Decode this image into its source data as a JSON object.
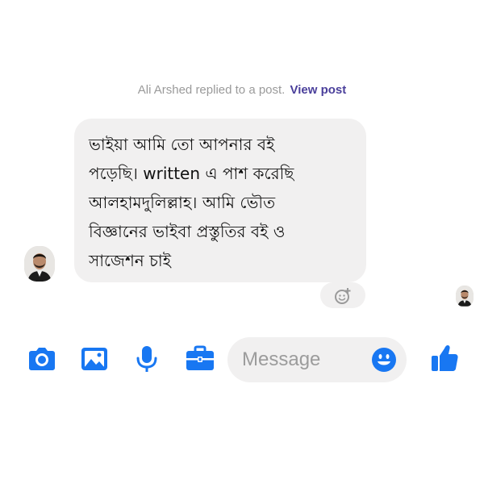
{
  "notice": {
    "text": "Ali Arshed replied to a post.",
    "link": "View post"
  },
  "message": {
    "text": "ভাইয়া আমি তো আপনার বই\nপড়েছি। written এ পাশ করেছি\nআলহামদুলিল্লাহ।  আমি ভৌত\nবিজ্ঞানের ভাইবা প্রস্তুতির বই ও\nসাজেশন চাই"
  },
  "composer": {
    "placeholder": "Message",
    "value": ""
  },
  "colors": {
    "accent": "#1877f2",
    "bubble": "#f1f0f0",
    "link": "#4a3f9b"
  },
  "icons": [
    "camera-icon",
    "image-icon",
    "microphone-icon",
    "briefcase-icon",
    "emoji-icon",
    "like-icon",
    "add-reaction-icon"
  ]
}
